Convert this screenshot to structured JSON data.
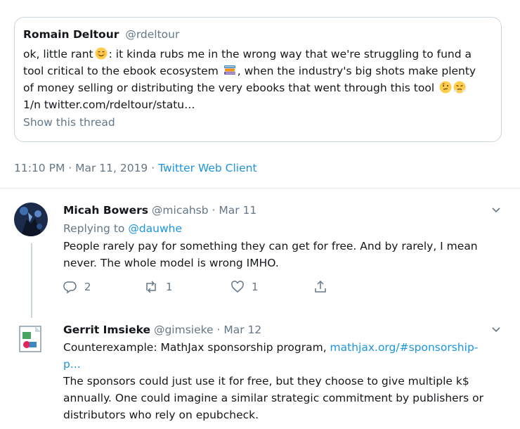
{
  "quote": {
    "name": "Romain Deltour",
    "handle": "@rdeltour",
    "text_1": "ok, little rant",
    "text_2": ": it kinda rubs me in the wrong way that we're struggling to fund a",
    "text_3": "tool critical to the ebook ecosystem",
    "text_4": ", when the industry's big shots make plenty",
    "text_5": "of money selling or distributing the very ebooks that went through this tool",
    "text_6": "1/n twitter.com/rdeltour/statu…",
    "show_thread": "Show this thread",
    "emoji_1": "relieved-face-emoji",
    "emoji_2": "books-emoji",
    "emoji_3": "thinking-face-emoji",
    "emoji_4": "steam-face-emoji"
  },
  "meta": {
    "time": "11:10 PM · Mar 11, 2019 · ",
    "client": "Twitter Web Client"
  },
  "reply1": {
    "name": "Micah Bowers",
    "handle": "@micahsb",
    "date": "· Mar 11",
    "replying_prefix": "Replying to ",
    "replying_to": "@dauwhe",
    "text_1": "People rarely pay for something they can get for free. And by rarely, I mean",
    "text_2": "never. The whole model is wrong IMHO.",
    "replies": "2",
    "retweets": "1",
    "likes": "1"
  },
  "reply2": {
    "name": "Gerrit Imsieke",
    "handle": "@gimsieke",
    "date": "· Mar 12",
    "text_1": "Counterexample: MathJax sponsorship program, ",
    "link_1": "mathjax.org/#sponsorship-",
    "link_2": "p...",
    "text_2": "The sponsors could just use it for free, but they choose to give multiple k$",
    "text_3": "annually. One could imagine a similar strategic commitment by publishers or",
    "text_4": "distributors who rely on epubcheck."
  },
  "colors": {
    "link": "#1b95e0",
    "secondary": "#657786",
    "border": "#ccd6dd"
  }
}
